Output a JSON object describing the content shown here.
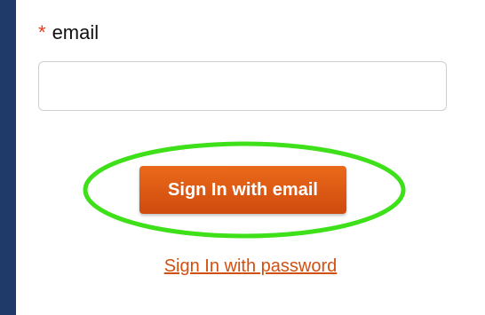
{
  "form": {
    "required_marker": "*",
    "email_label": "email",
    "email_value": "",
    "email_placeholder": "",
    "signin_email_label": "Sign In with email",
    "signin_password_label": "Sign In with password"
  },
  "colors": {
    "background": "#1f3a68",
    "required_marker": "#e53d1b",
    "button": "#e0590f",
    "link": "#d2500f",
    "highlight_ring": "#3ee01a"
  }
}
